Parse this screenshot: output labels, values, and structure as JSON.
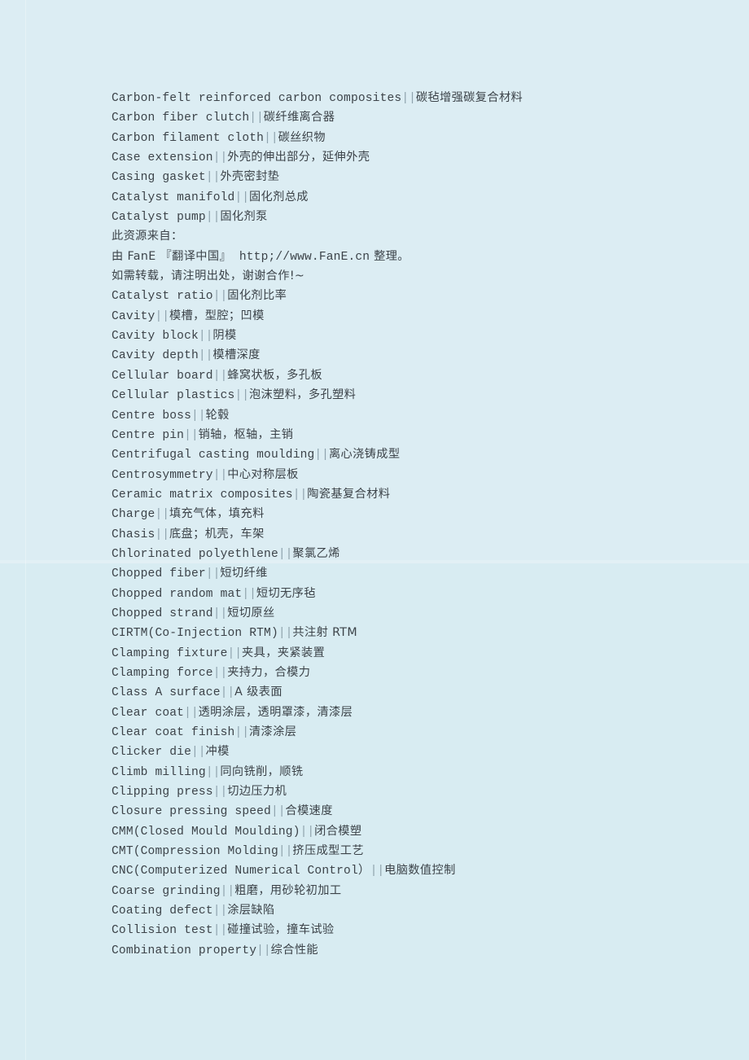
{
  "document": {
    "kind": "glossary-page",
    "language_pair": "English-Chinese",
    "background_color": "#daedf3",
    "text_color": "#3c4349",
    "separator_color": "#8fa3ad",
    "separator": "||"
  },
  "notice": {
    "line1": "此资源来自：",
    "line2_prefix": "由 FanE 『翻译中国』  ",
    "line2_url": "http;//www.FanE.cn",
    "line2_suffix": " 整理。",
    "line3": "如需转载，请注明出处，谢谢合作!~"
  },
  "entries": [
    {
      "term": "Carbon-felt reinforced carbon composites",
      "definition": "碳毡增强碳复合材料"
    },
    {
      "term": "Carbon fiber clutch",
      "definition": "碳纤维离合器"
    },
    {
      "term": "Carbon filament cloth",
      "definition": "碳丝织物"
    },
    {
      "term": "Case extension",
      "definition": "外壳的伸出部分，延伸外壳"
    },
    {
      "term": "Casing gasket",
      "definition": "外壳密封垫"
    },
    {
      "term": "Catalyst manifold",
      "definition": "固化剂总成"
    },
    {
      "term": "Catalyst pump",
      "definition": "固化剂泵"
    },
    {
      "term": "Catalyst ratio",
      "definition": "固化剂比率"
    },
    {
      "term": "Cavity",
      "definition": "模槽，型腔；凹模"
    },
    {
      "term": "Cavity block",
      "definition": "阴模"
    },
    {
      "term": "Cavity depth",
      "definition": "模槽深度"
    },
    {
      "term": "Cellular board",
      "definition": "蜂窝状板，多孔板"
    },
    {
      "term": "Cellular plastics",
      "definition": "泡沫塑料，多孔塑料"
    },
    {
      "term": "Centre boss",
      "definition": "轮毂"
    },
    {
      "term": "Centre pin",
      "definition": "销轴，枢轴，主销"
    },
    {
      "term": "Centrifugal casting moulding",
      "definition": "离心浇铸成型"
    },
    {
      "term": "Centrosymmetry",
      "definition": "中心对称层板"
    },
    {
      "term": "Ceramic matrix composites",
      "definition": "陶瓷基复合材料"
    },
    {
      "term": "Charge",
      "definition": "填充气体，填充料"
    },
    {
      "term": "Chasis",
      "definition": "底盘；机壳，车架"
    },
    {
      "term": "Chlorinated polyethlene",
      "definition": "聚氯乙烯"
    },
    {
      "term": "Chopped fiber",
      "definition": "短切纤维"
    },
    {
      "term": "Chopped random mat",
      "definition": "短切无序毡"
    },
    {
      "term": "Chopped strand",
      "definition": "短切原丝"
    },
    {
      "term": "CIRTM(Co-Injection RTM)",
      "definition": "共注射 RTM"
    },
    {
      "term": "Clamping fixture",
      "definition": "夹具，夹紧装置"
    },
    {
      "term": "Clamping force",
      "definition": "夹持力，合模力"
    },
    {
      "term": "Class A surface",
      "definition": "A 级表面"
    },
    {
      "term": "Clear coat",
      "definition": "透明涂层，透明罩漆，清漆层"
    },
    {
      "term": "Clear coat finish",
      "definition": "清漆涂层"
    },
    {
      "term": "Clicker die",
      "definition": "冲模"
    },
    {
      "term": "Climb milling",
      "definition": "同向铣削，顺铣"
    },
    {
      "term": "Clipping press",
      "definition": "切边压力机"
    },
    {
      "term": "Closure pressing speed",
      "definition": "合模速度"
    },
    {
      "term": "CMM(Closed Mould Moulding)",
      "definition": "闭合模塑"
    },
    {
      "term": "CMT(Compression Molding",
      "definition": "挤压成型工艺"
    },
    {
      "term": "CNC(Computerized Numerical Control）",
      "definition": "电脑数值控制"
    },
    {
      "term": "Coarse grinding",
      "definition": "粗磨，用砂轮初加工"
    },
    {
      "term": "Coating defect",
      "definition": "涂层缺陷"
    },
    {
      "term": "Collision test",
      "definition": "碰撞试验，撞车试验"
    },
    {
      "term": "Combination property",
      "definition": "综合性能"
    }
  ]
}
